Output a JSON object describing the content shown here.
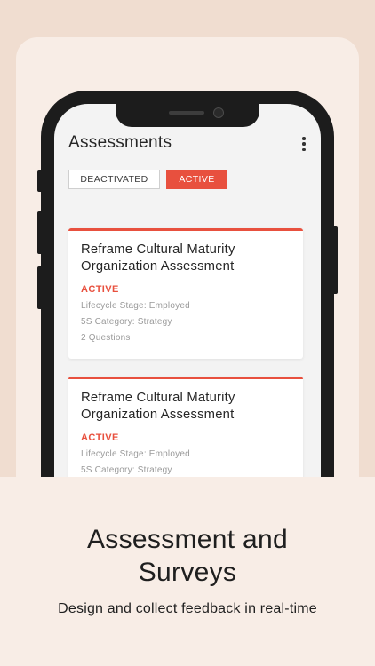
{
  "app": {
    "title": "Assessments"
  },
  "tabs": [
    {
      "label": "DEACTIVATED",
      "selected": false
    },
    {
      "label": "ACTIVE",
      "selected": true
    }
  ],
  "cards": [
    {
      "title_line1": "Reframe Cultural Maturity",
      "title_line2": "Organization Assessment",
      "status": "ACTIVE",
      "lifecycle": "Lifecycle Stage: Employed",
      "category": "5S Category: Strategy",
      "questions": "2 Questions"
    },
    {
      "title_line1": "Reframe Cultural Maturity",
      "title_line2": "Organization Assessment",
      "status": "ACTIVE",
      "lifecycle": "Lifecycle Stage: Employed",
      "category": "5S Category: Strategy"
    }
  ],
  "promo": {
    "headline_line1": "Assessment and",
    "headline_line2": "Surveys",
    "subtitle": "Design and collect feedback in real-time"
  },
  "colors": {
    "accent": "#e8503e",
    "background": "#f0ddd0",
    "panel": "#f8ede6",
    "phone_frame": "#1c1c1c"
  },
  "icons": {
    "menu": "kebab-menu-icon"
  }
}
